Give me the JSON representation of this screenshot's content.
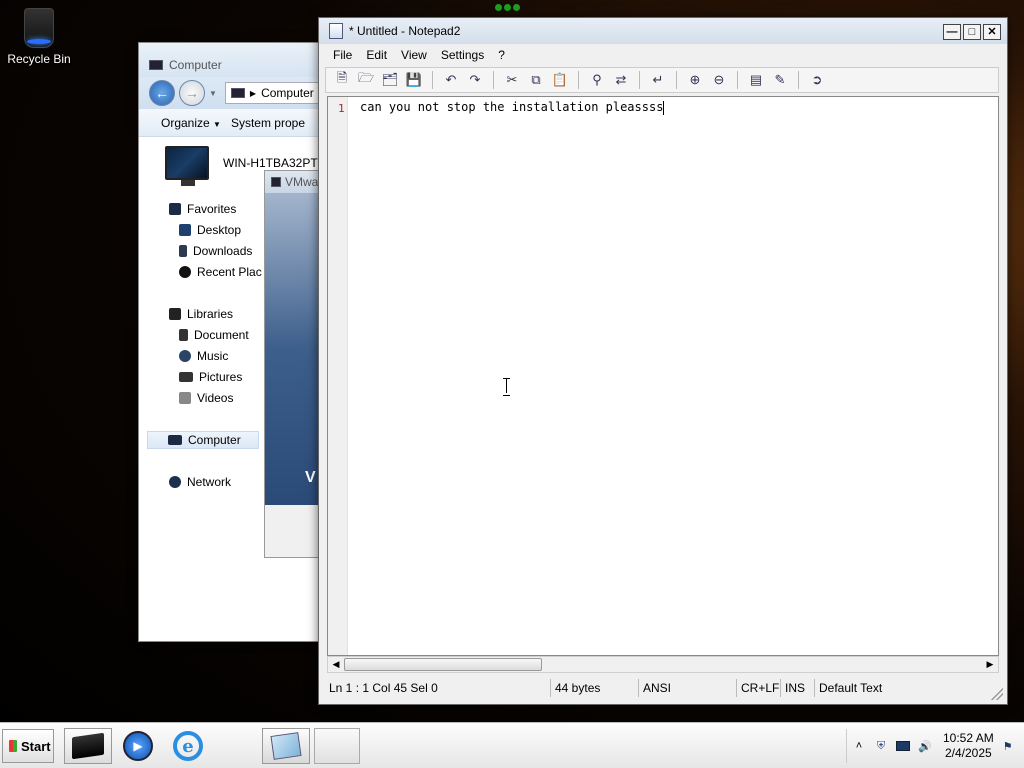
{
  "desktop": {
    "recycle_bin_label": "Recycle Bin"
  },
  "explorer": {
    "title": "Computer",
    "address": "Computer",
    "toolbar": {
      "organize": "Organize",
      "system_properties": "System prope"
    },
    "computer_name": "WIN-H1TBA32PT",
    "nav": {
      "favorites": "Favorites",
      "desktop": "Desktop",
      "downloads": "Downloads",
      "recent": "Recent Plac",
      "libraries": "Libraries",
      "documents": "Document",
      "music": "Music",
      "pictures": "Pictures",
      "videos": "Videos",
      "computer": "Computer",
      "network": "Network"
    }
  },
  "vmware": {
    "title": "VMwa",
    "logo_letter": "V"
  },
  "notepad": {
    "title": "* Untitled - Notepad2",
    "menu": [
      "File",
      "Edit",
      "View",
      "Settings",
      "?"
    ],
    "line_number": "1",
    "content": "can you not stop the installation pleassss",
    "status": {
      "position": "Ln 1 : 1   Col 45   Sel 0",
      "size": "44 bytes",
      "encoding": "ANSI",
      "line_endings": "CR+LF",
      "mode": "INS",
      "scheme": "Default Text"
    }
  },
  "taskbar": {
    "start_label": "Start",
    "clock_time": "10:52 AM",
    "clock_date": "2/4/2025"
  },
  "colors": {
    "line_number": "#c02020",
    "taskbar_bg": "#f0f0f0",
    "title_bar": "#d3deea"
  }
}
